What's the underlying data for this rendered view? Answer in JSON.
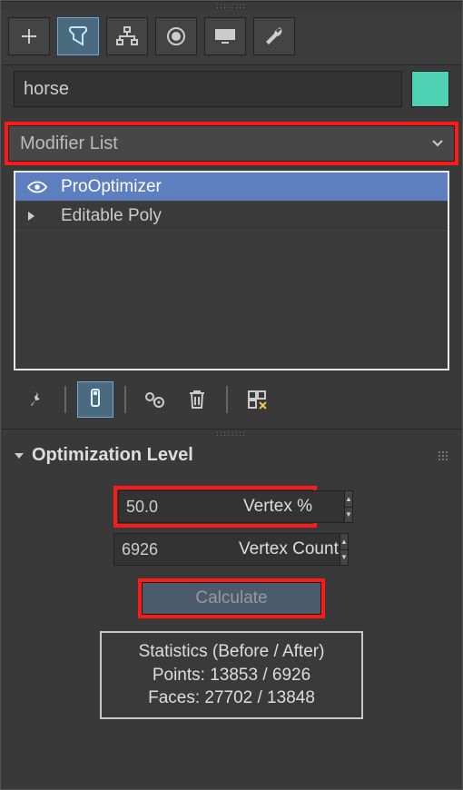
{
  "object": {
    "name": "horse",
    "swatch_color": "#4fd1b3"
  },
  "modifier_dropdown": {
    "label": "Modifier List"
  },
  "stack": [
    {
      "label": "ProOptimizer",
      "selected": true,
      "visible_icon": "eye"
    },
    {
      "label": "Editable Poly",
      "selected": false,
      "visible_icon": "arrow"
    }
  ],
  "rollout": {
    "title": "Optimization Level",
    "vertex_pct": {
      "value": "50.0",
      "label": "Vertex %"
    },
    "vertex_count": {
      "value": "6926",
      "label": "Vertex Count"
    },
    "calculate_label": "Calculate",
    "stats": {
      "heading": "Statistics (Before / After)",
      "points": "Points: 13853 / 6926",
      "faces": "Faces: 27702 / 13848"
    }
  }
}
